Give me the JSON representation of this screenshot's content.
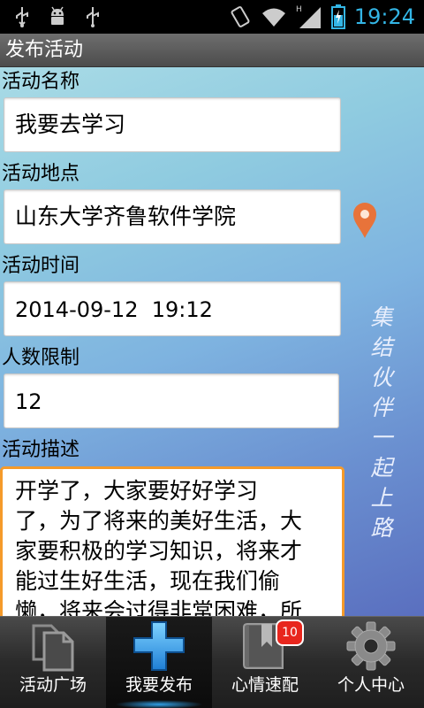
{
  "status_bar": {
    "time": "19:24",
    "icons": [
      "usb-icon",
      "android-debug-icon",
      "usb-icon",
      "rotate-icon",
      "wifi-icon",
      "signal-icon",
      "battery-icon"
    ],
    "accent_color": "#33b5e5"
  },
  "header": {
    "title": "发布活动"
  },
  "form": {
    "name": {
      "label": "活动名称",
      "value": "我要去学习"
    },
    "location": {
      "label": "活动地点",
      "value": "山东大学齐鲁软件学院",
      "icon": "location-pin-icon",
      "icon_color": "#e8733a"
    },
    "time": {
      "label": "活动时间",
      "value": "2014-09-12  19:12"
    },
    "limit": {
      "label": "人数限制",
      "value": "12"
    },
    "description": {
      "label": "活动描述",
      "lines": [
        "开学了，大家要好好学习",
        "了，为了将来的美好生活，大",
        "家要积极的学习知识，将来才",
        "能过生好生活，现在我们偷",
        "懒，将来会过得非常困难，所"
      ],
      "focus_color": "#f59a2a"
    }
  },
  "background_text": "集结伙伴一起上路",
  "tabs": [
    {
      "label": "活动广场",
      "icon": "copy-pages-icon",
      "active": false
    },
    {
      "label": "我要发布",
      "icon": "plus-icon",
      "active": true
    },
    {
      "label": "心情速配",
      "icon": "bookmark-book-icon",
      "active": false,
      "badge": "10"
    },
    {
      "label": "个人中心",
      "icon": "gear-icon",
      "active": false
    }
  ]
}
